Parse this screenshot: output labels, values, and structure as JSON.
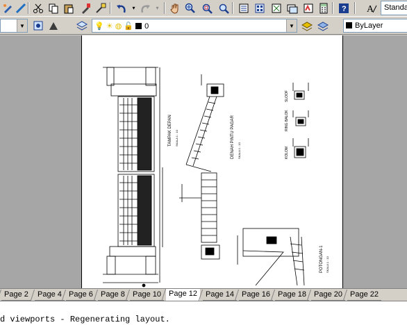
{
  "toolbar": {
    "icons": [
      "color-pen-icon",
      "cut-icon",
      "copy-icon",
      "paste-icon",
      "match-properties-icon",
      "paint-brush-icon",
      "undo-icon",
      "redo-icon",
      "pan-icon",
      "zoom-realtime-icon",
      "zoom-window-icon",
      "zoom-previous-icon",
      "properties-icon",
      "design-center-icon",
      "tool-palettes-icon",
      "sheet-set-icon",
      "markup-icon",
      "calculator-icon",
      "help-icon",
      "text-style-icon"
    ],
    "text_style_value": "Standa"
  },
  "layers_toolbar": {
    "layer_value": "0",
    "linetype_color_value": "ByLayer"
  },
  "tabs": [
    "Page 2",
    "Page 4",
    "Page 6",
    "Page 8",
    "Page 10",
    "Page 12",
    "Page 14",
    "Page 16",
    "Page 18",
    "Page 20",
    "Page 22"
  ],
  "active_tab": "Page 12",
  "drawing": {
    "labels": {
      "tampak_depan": "TAMPAK DEPAN",
      "tampak_depan_scale": "SKALA 1 : 10",
      "denah_pintu": "DENAH PINTU PAGAR",
      "denah_pintu_scale": "SKALA 1 : 10",
      "sloof": "SLOOF",
      "ring_balok": "RING BALOK",
      "kolom": "KOLOM",
      "potongan": "POTONGAN-1",
      "potongan_scale": "SKALA 1 : 10"
    }
  },
  "command_line": {
    "text": "d viewports - Regenerating layout."
  }
}
